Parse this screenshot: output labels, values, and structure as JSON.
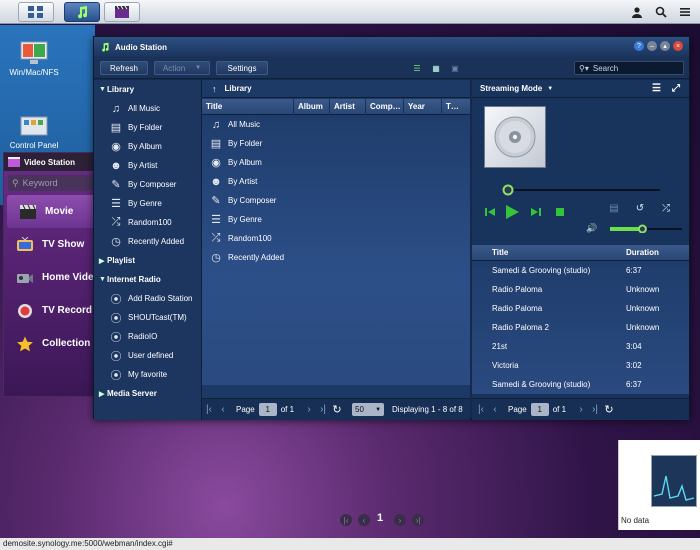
{
  "desktop": {
    "icons": [
      {
        "label": "Win/Mac/NFS",
        "icon": "monitor-icon"
      },
      {
        "label": "Control Panel",
        "icon": "control-panel-icon"
      }
    ]
  },
  "topbar": {
    "buttons": [
      "grid-icon",
      "music-note-icon",
      "film-icon"
    ],
    "right": [
      "user-icon",
      "search-icon",
      "menu-icon"
    ]
  },
  "video_station": {
    "title": "Video Station",
    "search_placeholder": "Keyword",
    "items": [
      {
        "label": "Movie",
        "icon": "clapper-icon"
      },
      {
        "label": "TV Show",
        "icon": "tv-icon"
      },
      {
        "label": "Home Vide",
        "icon": "camcorder-icon"
      },
      {
        "label": "TV Record",
        "icon": "record-icon"
      },
      {
        "label": "Collection",
        "icon": "star-icon"
      }
    ]
  },
  "audio_station": {
    "title": "Audio Station",
    "toolbar": {
      "refresh": "Refresh",
      "action": "Action",
      "settings": "Settings",
      "search_placeholder": "Search"
    },
    "tree": {
      "library": {
        "label": "Library",
        "items": [
          {
            "label": "All Music",
            "icon": "music-note-icon"
          },
          {
            "label": "By Folder",
            "icon": "folder-icon"
          },
          {
            "label": "By Album",
            "icon": "disc-icon"
          },
          {
            "label": "By Artist",
            "icon": "person-icon"
          },
          {
            "label": "By Composer",
            "icon": "composer-icon"
          },
          {
            "label": "By Genre",
            "icon": "list-icon"
          },
          {
            "label": "Random100",
            "icon": "shuffle-icon"
          },
          {
            "label": "Recently Added",
            "icon": "recent-icon"
          }
        ]
      },
      "playlist": {
        "label": "Playlist"
      },
      "radio": {
        "label": "Internet Radio",
        "items": [
          {
            "label": "Add Radio Station"
          },
          {
            "label": "SHOUTcast(TM)"
          },
          {
            "label": "RadioIO"
          },
          {
            "label": "User defined"
          },
          {
            "label": "My favorite"
          }
        ]
      },
      "media_server": {
        "label": "Media Server"
      }
    },
    "browser": {
      "breadcrumb": "Library",
      "columns": [
        "Title",
        "Album",
        "Artist",
        "Comp…",
        "Year",
        "T…"
      ],
      "rows": [
        {
          "label": "All Music",
          "icon": "music-note-icon"
        },
        {
          "label": "By Folder",
          "icon": "folder-icon"
        },
        {
          "label": "By Album",
          "icon": "disc-icon"
        },
        {
          "label": "By Artist",
          "icon": "person-icon"
        },
        {
          "label": "By Composer",
          "icon": "composer-icon"
        },
        {
          "label": "By Genre",
          "icon": "list-icon"
        },
        {
          "label": "Random100",
          "icon": "shuffle-icon"
        },
        {
          "label": "Recently Added",
          "icon": "recent-icon"
        }
      ],
      "pager": {
        "page_label": "Page",
        "page": "1",
        "of": "of 1",
        "per_page": "50",
        "displaying": "Displaying 1 - 8 of 8"
      }
    },
    "player": {
      "mode": "Streaming Mode",
      "progress": 0.0,
      "volume": 0.45,
      "playlist_columns": [
        "Title",
        "Duration"
      ],
      "playlist": [
        {
          "title": "Samedi & Grooving (studio)",
          "duration": "6:37"
        },
        {
          "title": "Radio Paloma",
          "duration": "Unknown"
        },
        {
          "title": "Radio Paloma",
          "duration": "Unknown"
        },
        {
          "title": "Radio Paloma 2",
          "duration": "Unknown"
        },
        {
          "title": "21st",
          "duration": "3:04"
        },
        {
          "title": "Victoria",
          "duration": "3:02"
        },
        {
          "title": "Samedi & Grooving (studio)",
          "duration": "6:37"
        }
      ],
      "pager": {
        "page_label": "Page",
        "page": "1",
        "of": "of 1"
      }
    }
  },
  "bottom_pager": {
    "page": "1"
  },
  "widget": {
    "label": "No data"
  },
  "status_bar": "demosite.synology.me:5000/webman/index.cgi#",
  "colors": {
    "accent": "#2a4775",
    "play": "#34c43a",
    "video_bg": "#5a2a6e"
  }
}
